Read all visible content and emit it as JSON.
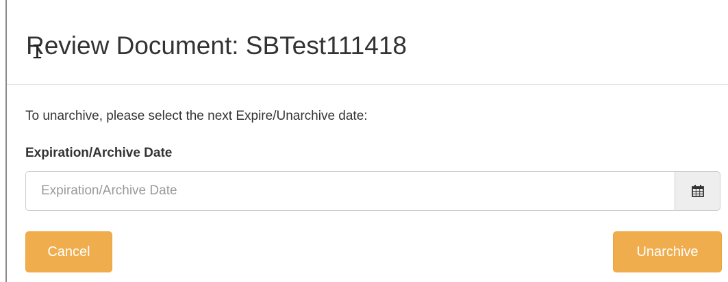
{
  "modal": {
    "title": "Review Document: SBTest111418",
    "instruction": "To unarchive, please select the next Expire/Unarchive date:",
    "field_label": "Expiration/Archive Date",
    "date_input": {
      "value": "",
      "placeholder": "Expiration/Archive Date"
    },
    "calendar_icon": "calendar-icon",
    "cancel_label": "Cancel",
    "unarchive_label": "Unarchive"
  },
  "colors": {
    "button_warning": "#f0ad4e",
    "button_border": "#eea236",
    "header_divider": "#e5e5e5",
    "input_border": "#cccccc",
    "addon_bg": "#eeeeee"
  }
}
